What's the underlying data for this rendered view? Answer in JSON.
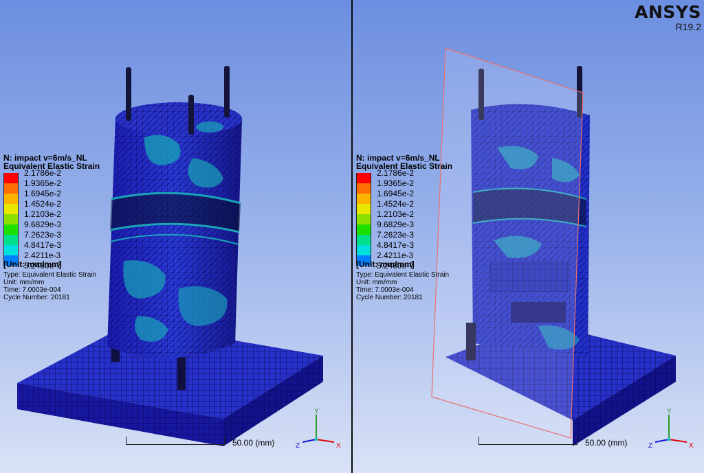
{
  "brand": {
    "name": "ANSYS",
    "version": "R19.2"
  },
  "colors": {
    "mesh_dark": "#1a1ab0",
    "mesh_mid": "#2233dd",
    "mesh_cyan": "#1aa5b8",
    "plane_outline": "#e87070"
  },
  "legend": {
    "title_line1": "N: impact v=6m/s_NL",
    "title_line2": "Equivalent Elastic Strain",
    "values": [
      "2.1786e-2",
      "1.9365e-2",
      "1.6945e-2",
      "1.4524e-2",
      "1.2103e-2",
      "9.6829e-3",
      "7.2623e-3",
      "4.8417e-3",
      "2.4211e-3",
      "5.2480e-7"
    ],
    "colors": [
      "#ff0000",
      "#ff6e00",
      "#ffb400",
      "#e8e800",
      "#8ee000",
      "#1ee000",
      "#00e08a",
      "#00dede",
      "#0080ff",
      "#0000ff"
    ],
    "unit": "[Unit: mm/mm]",
    "info": {
      "type": "Type: Equivalent Elastic Strain",
      "unit": "Unit: mm/mm",
      "time": "Time: 7.0003e-004",
      "cycle": "Cycle Number: 20181"
    }
  },
  "scale": {
    "label": "50.00  (mm)"
  },
  "triad": {
    "x": "X",
    "y": "Y",
    "z": "Z"
  },
  "viewports": {
    "left": {
      "view": "full-model"
    },
    "right": {
      "view": "section-plane"
    }
  }
}
